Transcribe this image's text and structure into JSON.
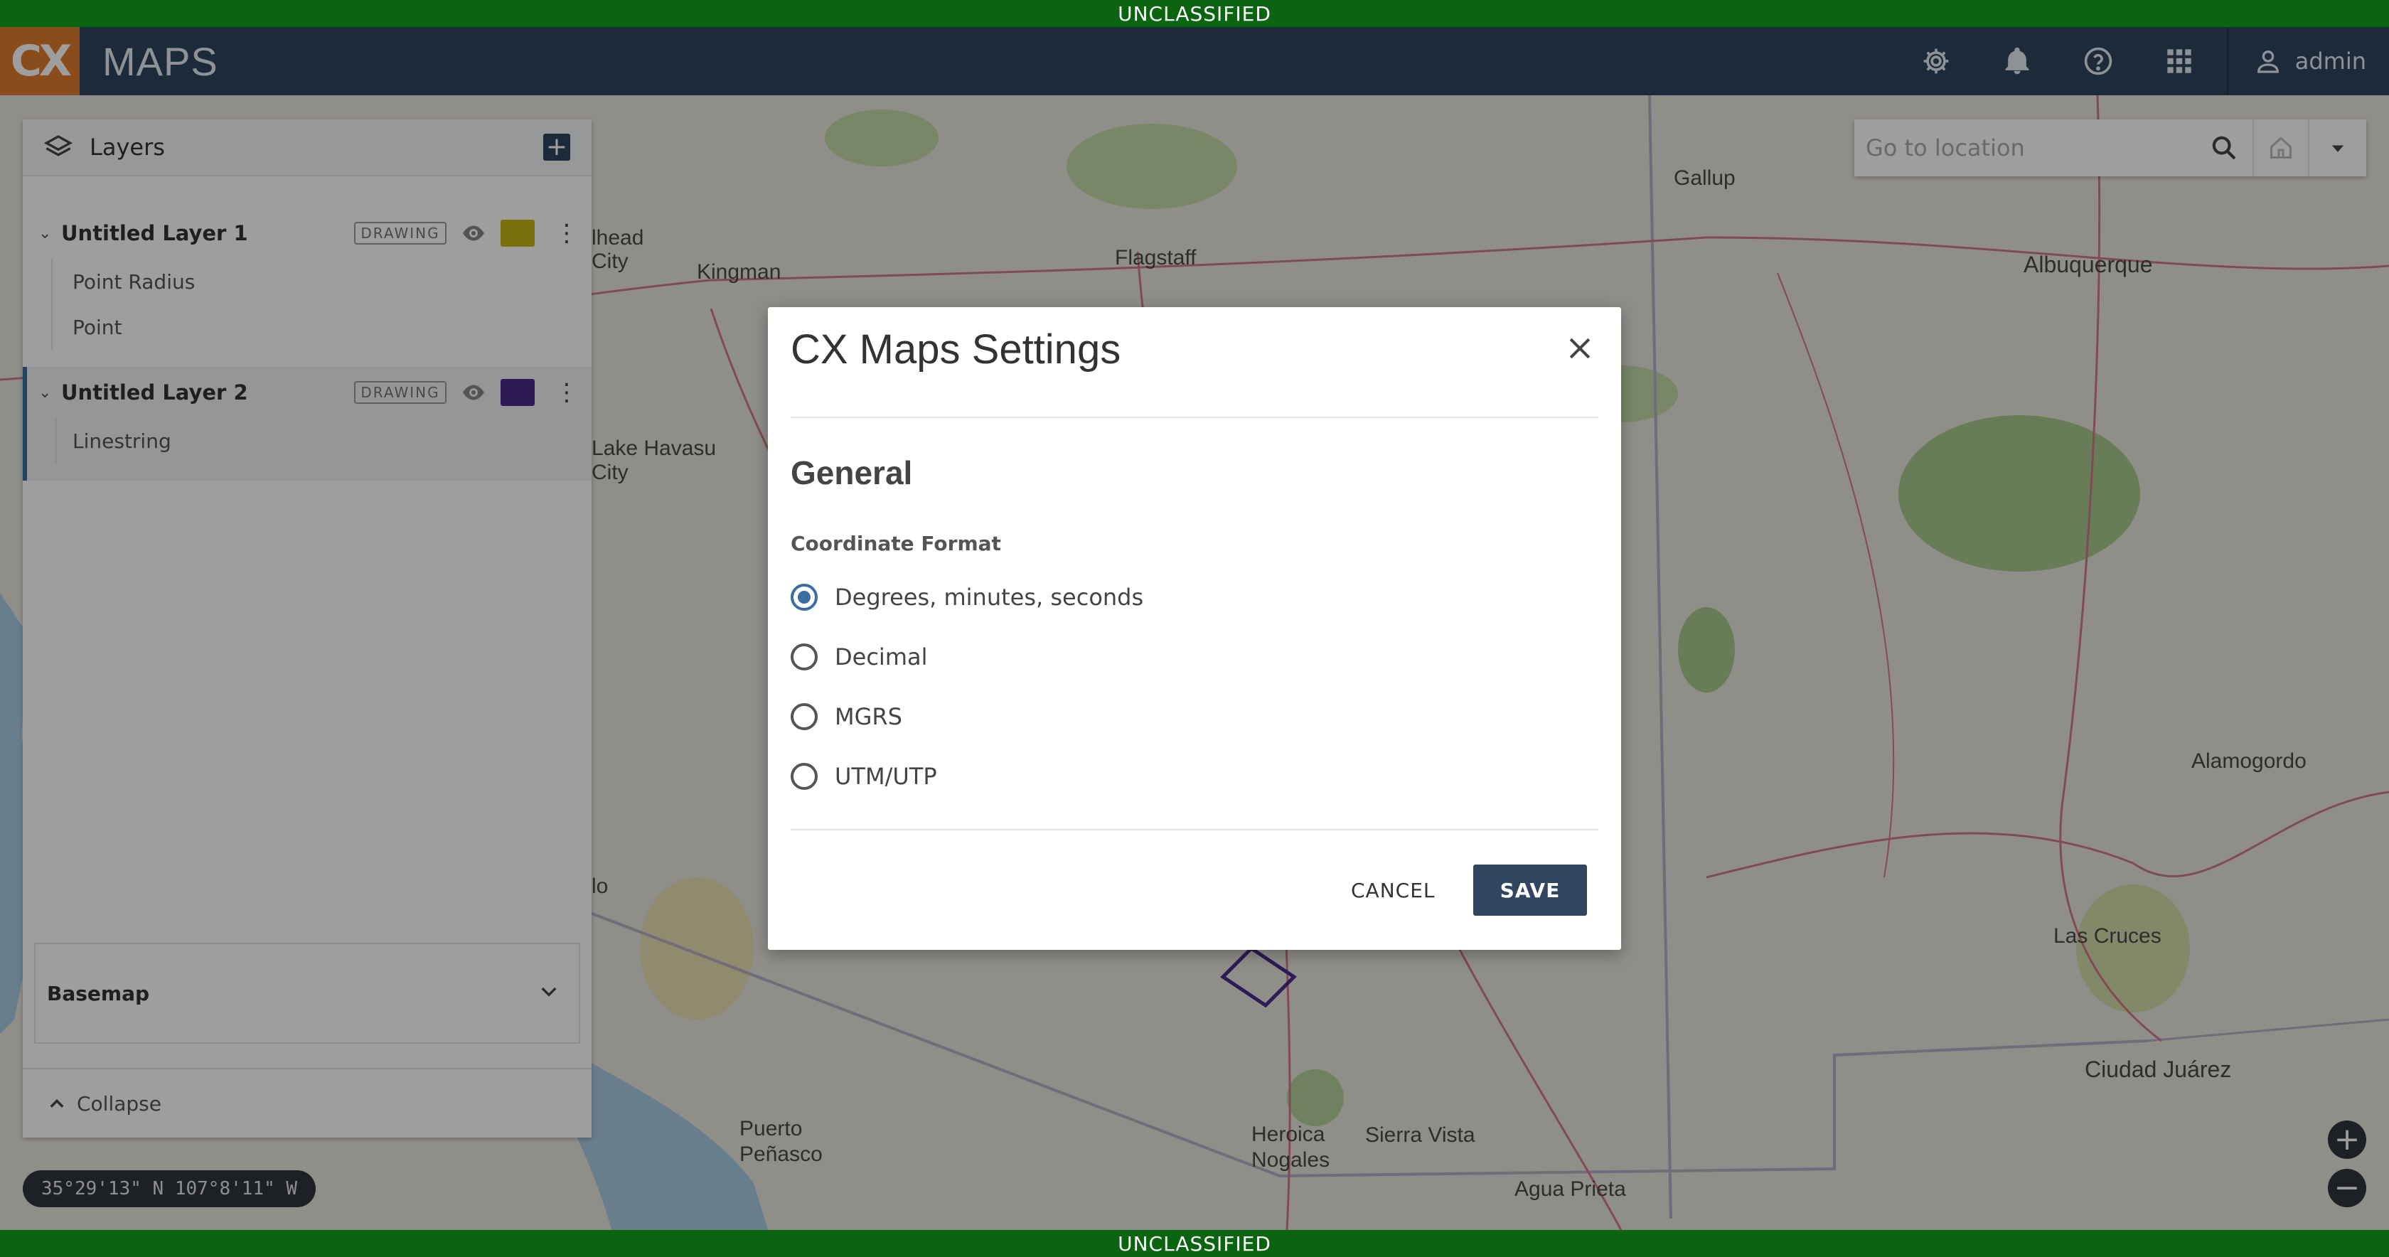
{
  "classification": {
    "top": "UNCLASSIFIED",
    "bottom": "UNCLASSIFIED"
  },
  "header": {
    "logo_text": "CX",
    "app_title": "MAPS",
    "icons": [
      "settings-gear-icon",
      "bell-icon",
      "help-icon",
      "apps-grid-icon",
      "user-icon"
    ],
    "username": "admin"
  },
  "layers_panel": {
    "title": "Layers",
    "layers": [
      {
        "name": "Untitled Layer 1",
        "tag": "DRAWING",
        "color": "#c9b514",
        "features": [
          "Point Radius",
          "Point"
        ]
      },
      {
        "name": "Untitled Layer 2",
        "tag": "DRAWING",
        "color": "#4b2a8c",
        "features": [
          "Linestring"
        ]
      }
    ],
    "basemap_label": "Basemap",
    "collapse_label": "Collapse"
  },
  "coordinates_readout": "35°29'13\" N 107°8'11\" W",
  "search": {
    "placeholder": "Go to location",
    "value": ""
  },
  "map_labels": [
    {
      "name": "Kingman"
    },
    {
      "name": "Flagstaff"
    },
    {
      "name": "Gallup"
    },
    {
      "name": "Albuquerque"
    },
    {
      "name": "Lake Havasu City"
    },
    {
      "name": "Alamogordo"
    },
    {
      "name": "Las Cruces"
    },
    {
      "name": "Ciudad Juárez"
    },
    {
      "name": "Puerto Peñasco"
    },
    {
      "name": "Heroica Nogales"
    },
    {
      "name": "Sierra Vista"
    },
    {
      "name": "Agua Prieta"
    },
    {
      "name": "lhead City"
    },
    {
      "name": "lo"
    }
  ],
  "modal": {
    "title": "CX Maps Settings",
    "section": "General",
    "field_label": "Coordinate Format",
    "options": [
      "Degrees, minutes, seconds",
      "Decimal",
      "MGRS",
      "UTM/UTP"
    ],
    "selected_option": "Degrees, minutes, seconds",
    "cancel_label": "CANCEL",
    "save_label": "SAVE"
  },
  "colors": {
    "header": "#30455e",
    "banner": "#0a6410",
    "accent": "#3b6ea0",
    "logo": "#e07b2c"
  }
}
